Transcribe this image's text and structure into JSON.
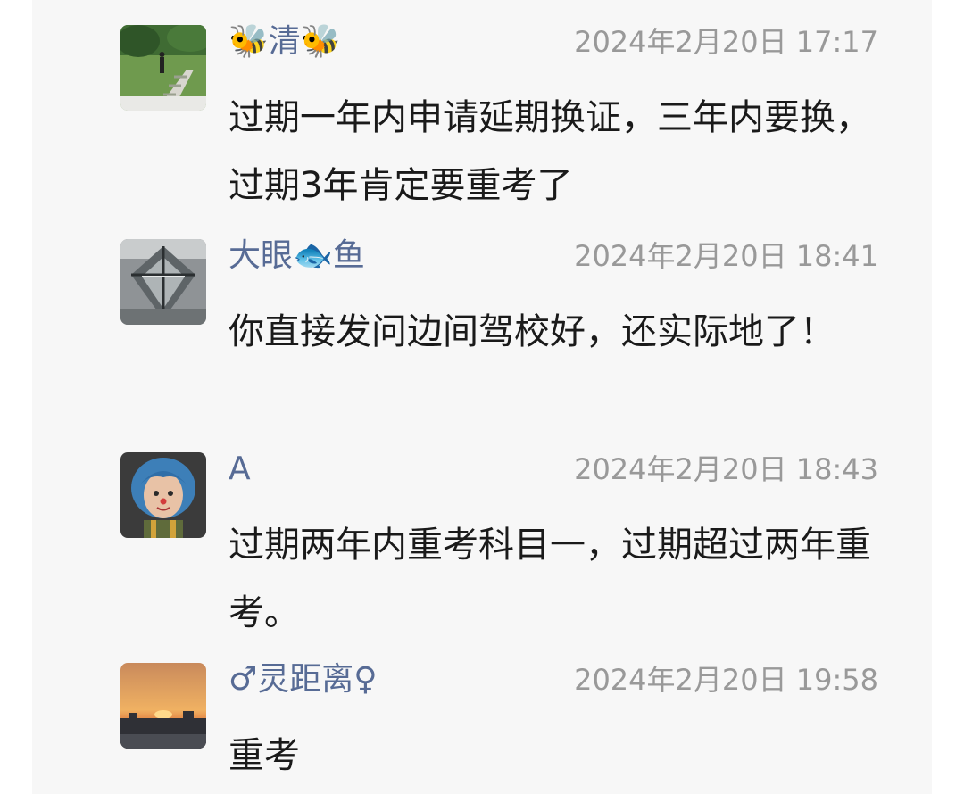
{
  "comments": [
    {
      "avatar_icon": "garden-path-photo-avatar",
      "nickname": "🐝清🐝",
      "timestamp": "2024年2月20日 17:17",
      "text": "过期一年内申请延期换证，三年内要换，过期3年肯定要重考了"
    },
    {
      "avatar_icon": "glass-structure-photo-avatar",
      "nickname": "大眼🐟鱼",
      "timestamp": "2024年2月20日 18:41",
      "text": "你直接发问边间驾校好，还实际地了！"
    },
    {
      "avatar_icon": "blue-hair-girl-avatar",
      "nickname": "A",
      "timestamp": "2024年2月20日 18:43",
      "text": "过期两年内重考科目一，过期超过两年重考。"
    },
    {
      "avatar_icon": "sunset-photo-avatar",
      "nickname": "♂灵距离♀",
      "timestamp": "2024年2月20日 19:58",
      "text": "重考"
    }
  ],
  "colors": {
    "nickname": "#576b95",
    "timestamp": "#999999",
    "text": "#1a1a1a",
    "panel_bg": "#f7f7f7"
  }
}
